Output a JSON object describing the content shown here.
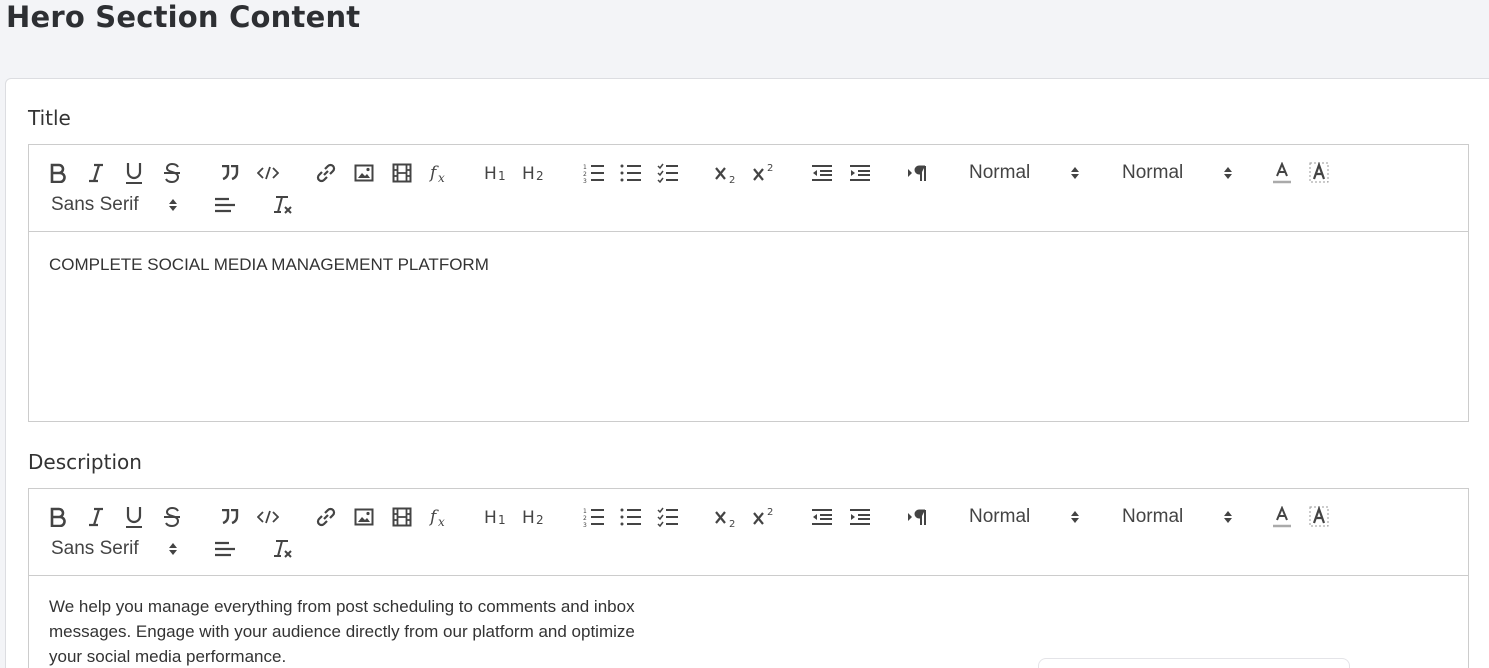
{
  "page": {
    "title": "Hero Section Content"
  },
  "fields": [
    {
      "label": "Title",
      "content": "COMPLETE SOCIAL MEDIA MANAGEMENT PLATFORM"
    },
    {
      "label": "Description",
      "content": "We help you manage everything from post scheduling to comments and inbox messages. Engage with your audience directly from our platform and optimize your social media performance."
    }
  ],
  "toolbar": {
    "header_picker": "Normal",
    "size_picker": "Normal",
    "font_picker": "Sans Serif",
    "buttons": [
      "bold-icon",
      "italic-icon",
      "underline-icon",
      "strikethrough-icon",
      "blockquote-icon",
      "code-block-icon",
      "link-icon",
      "image-icon",
      "video-icon",
      "formula-icon",
      "h1-icon",
      "h2-icon",
      "ordered-list-icon",
      "bullet-list-icon",
      "check-list-icon",
      "subscript-icon",
      "superscript-icon",
      "outdent-icon",
      "indent-icon",
      "text-direction-icon",
      "text-color-icon",
      "background-color-icon",
      "align-icon",
      "clear-format-icon"
    ]
  }
}
